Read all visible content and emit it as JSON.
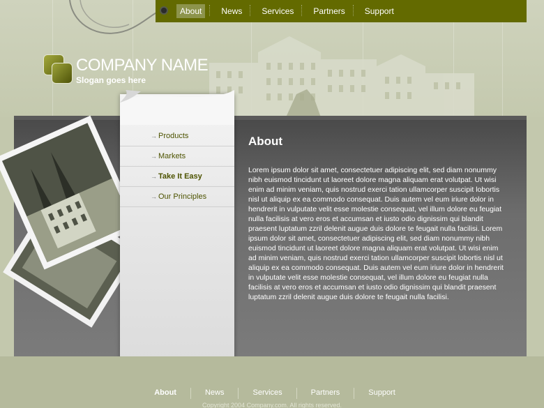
{
  "top_nav": {
    "items": [
      {
        "label": "About",
        "active": true
      },
      {
        "label": "News",
        "active": false
      },
      {
        "label": "Services",
        "active": false
      },
      {
        "label": "Partners",
        "active": false
      },
      {
        "label": "Support",
        "active": false
      }
    ]
  },
  "brand": {
    "company_name": "COMPANY NAME",
    "slogan": "Slogan goes here"
  },
  "side_menu": {
    "items": [
      {
        "label": "Products",
        "bold": false
      },
      {
        "label": "Markets",
        "bold": false
      },
      {
        "label": "Take It Easy",
        "bold": true
      },
      {
        "label": "Our Principles",
        "bold": false
      }
    ]
  },
  "content": {
    "title": "About",
    "body": "Lorem ipsum dolor sit amet, consectetuer adipiscing elit, sed diam nonummy nibh euismod tincidunt ut laoreet dolore magna aliquam erat volutpat. Ut wisi enim ad minim veniam, quis nostrud exerci tation ullamcorper suscipit lobortis nisl ut aliquip ex ea commodo consequat. Duis autem vel eum iriure dolor in hendrerit in vulputate velit esse molestie consequat, vel illum dolore eu feugiat nulla facilisis at vero eros et accumsan et iusto odio dignissim qui blandit praesent luptatum zzril delenit augue duis dolore te feugait nulla facilisi. Lorem ipsum dolor sit amet, consectetuer adipiscing elit, sed diam nonummy nibh euismod tincidunt ut laoreet dolore magna aliquam erat volutpat. Ut wisi enim ad minim veniam, quis nostrud exerci tation ullamcorper suscipit lobortis nisl ut aliquip ex ea commodo consequat. Duis autem vel eum iriure dolor in hendrerit in vulputate velit esse molestie consequat, vel illum dolore eu feugiat nulla facilisis at vero eros et accumsan et iusto odio dignissim qui blandit praesent luptatum zzril delenit augue duis dolore te feugait nulla facilisi."
  },
  "footer": {
    "nav": [
      {
        "label": "About",
        "active": true
      },
      {
        "label": "News",
        "active": false
      },
      {
        "label": "Services",
        "active": false
      },
      {
        "label": "Partners",
        "active": false
      },
      {
        "label": "Support",
        "active": false
      }
    ],
    "copyright": "Copyright 2004 Company.com. All rights reserved."
  },
  "colors": {
    "nav_bar": "#636a00",
    "active_tab": "#8d944c",
    "page_background": "#c3c8ad",
    "content_panel": "#6d6d6d",
    "menu_text": "#4d5300"
  },
  "icons": [
    "logo-squares-icon",
    "menu-arrow-icon",
    "hanging-hook-icon"
  ]
}
